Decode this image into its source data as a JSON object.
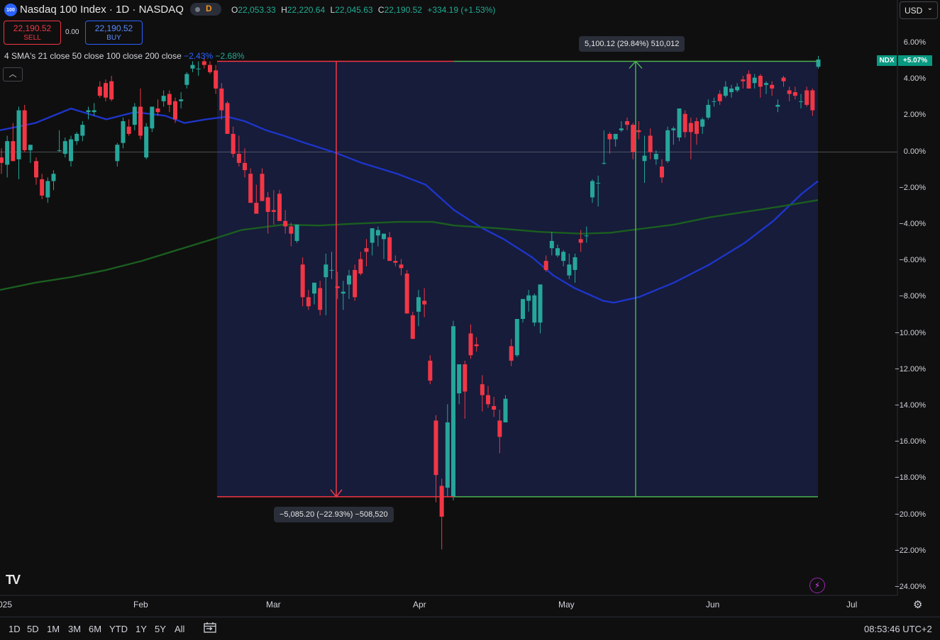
{
  "header": {
    "badge": "100",
    "title": "Nasdaq 100 Index · 1D · NASDAQ",
    "delay_letter": "D",
    "ohlc": [
      {
        "k": "O",
        "v": "22,053.33"
      },
      {
        "k": "H",
        "v": "22,220.64"
      },
      {
        "k": "L",
        "v": "22,045.63"
      },
      {
        "k": "C",
        "v": "22,190.52"
      }
    ],
    "change": "+334.19 (+1.53%)",
    "currency": "USD",
    "currency_chevron": "chevron-down-icon"
  },
  "trade": {
    "sell_price": "22,190.52",
    "sell_label": "SELL",
    "spread": "0.00",
    "buy_price": "22,190.52",
    "buy_label": "BUY"
  },
  "indicator": {
    "label": "4 SMA's 21 close 50 close 100 close 200 close",
    "val1": "−2.43%",
    "val2": "−2.68%",
    "collapse_icon": "chevron-up-icon"
  },
  "price_scale": {
    "labels": [
      "6.00%",
      "4.00%",
      "2.00%",
      "0.00%",
      "−2.00%",
      "−4.00%",
      "−6.00%",
      "−8.00%",
      "−10.00%",
      "−12.00%",
      "−14.00%",
      "−16.00%",
      "−18.00%",
      "−20.00%",
      "−22.00%",
      "−24.00%"
    ],
    "symbol_tag": "NDX",
    "last_pct": "+5.07%"
  },
  "time_scale": {
    "labels": [
      "025",
      "Feb",
      "Mar",
      "Apr",
      "May",
      "Jun",
      "Jul"
    ]
  },
  "measure": {
    "down": "−5,085.20 (−22.93%) −508,520",
    "up": "5,100.12 (29.84%) 510,012"
  },
  "colors": {
    "up": "#26a69a",
    "down": "#f23645",
    "sma_blue": "#1e35c9",
    "sma_green": "#1b5e20",
    "measure_fill": "#161c3a",
    "measure_up": "#4caf50",
    "measure_down": "#f23645"
  },
  "bottom": {
    "timeframes": [
      "1D",
      "5D",
      "1M",
      "3M",
      "6M",
      "YTD",
      "1Y",
      "5Y",
      "All"
    ],
    "clock": "08:53:46 UTC+2",
    "logo": "TV"
  },
  "chart_data": {
    "type": "candlestick",
    "y_unit": "% change",
    "ylim": [
      -24.9,
      6.9
    ],
    "y_ticks": [
      6,
      4,
      2,
      0,
      -2,
      -4,
      -6,
      -8,
      -10,
      -12,
      -14,
      -16,
      -18,
      -20,
      -22,
      -24
    ],
    "x_ticks": [
      "025",
      "Feb",
      "Mar",
      "Apr",
      "May",
      "Jun",
      "Jul"
    ],
    "grid": false,
    "candles": [
      [
        -0.3,
        0.2,
        -1.2,
        -0.6
      ],
      [
        -0.7,
        0.9,
        -1.4,
        0.6
      ],
      [
        0.6,
        1.6,
        -0.5,
        -0.5
      ],
      [
        -0.4,
        2.5,
        -1.5,
        2.3
      ],
      [
        2.3,
        2.6,
        0.0,
        0.1
      ],
      [
        0.1,
        0.3,
        -0.6,
        0.4
      ],
      [
        -0.5,
        -0.3,
        -1.8,
        -1.4
      ],
      [
        -1.5,
        -1.2,
        -2.6,
        -2.4
      ],
      [
        -2.5,
        -1.4,
        -2.8,
        -1.6
      ],
      [
        -1.6,
        -1.0,
        -2.1,
        -1.2
      ],
      [
        0.1,
        1.2,
        0.0,
        0.1
      ],
      [
        -0.1,
        0.8,
        -0.3,
        0.6
      ],
      [
        -0.5,
        0.9,
        -0.8,
        0.7
      ],
      [
        0.6,
        1.1,
        0.4,
        1.0
      ],
      [
        0.9,
        1.7,
        0.6,
        1.5
      ],
      [
        2.2,
        2.5,
        1.8,
        2.3
      ],
      [
        2.2,
        2.7,
        2.0,
        2.3
      ],
      [
        3.6,
        3.9,
        3.0,
        3.1
      ],
      [
        3.8,
        4.0,
        2.8,
        3.0
      ],
      [
        3.9,
        4.2,
        2.8,
        2.9
      ],
      [
        -0.5,
        0.5,
        -0.8,
        0.4
      ],
      [
        0.5,
        1.9,
        0.2,
        1.7
      ],
      [
        1.4,
        1.8,
        0.9,
        1.0
      ],
      [
        1.5,
        2.7,
        1.2,
        2.5
      ],
      [
        2.5,
        3.5,
        0.7,
        0.9
      ],
      [
        -0.3,
        1.6,
        -0.4,
        1.4
      ],
      [
        1.3,
        2.5,
        1.1,
        2.5
      ],
      [
        2.4,
        2.9,
        2.0,
        2.2
      ],
      [
        2.8,
        3.4,
        2.5,
        3.1
      ],
      [
        3.2,
        3.4,
        2.2,
        2.6
      ],
      [
        2.8,
        3.0,
        1.6,
        1.8
      ],
      [
        2.8,
        3.3,
        2.4,
        2.9
      ],
      [
        3.7,
        4.4,
        3.5,
        4.3
      ],
      [
        4.6,
        5.0,
        4.4,
        4.8
      ],
      [
        4.6,
        5.0,
        4.2,
        4.6
      ],
      [
        5.0,
        5.2,
        4.6,
        4.8
      ],
      [
        4.8,
        5.0,
        4.3,
        4.4
      ],
      [
        4.5,
        4.8,
        3.2,
        3.5
      ],
      [
        3.5,
        3.8,
        1.8,
        2.3
      ],
      [
        2.7,
        2.8,
        1.2,
        1.0
      ],
      [
        1.0,
        1.4,
        -0.3,
        -0.1
      ],
      [
        -0.1,
        0.9,
        -0.8,
        -0.6
      ],
      [
        -0.6,
        0.2,
        -1.4,
        -1.0
      ],
      [
        -1.2,
        -0.9,
        -2.8,
        -2.8
      ],
      [
        -2.8,
        -1.8,
        -3.4,
        -3.4
      ],
      [
        -1.2,
        -0.9,
        -2.7,
        -2.7
      ],
      [
        -2.5,
        -2.2,
        -4.5,
        -3.3
      ],
      [
        -3.2,
        -2.1,
        -4.0,
        -3.3
      ],
      [
        -2.3,
        -2.1,
        -3.8,
        -3.8
      ],
      [
        -3.8,
        -3.2,
        -4.5,
        -4.1
      ],
      [
        -4.1,
        -3.9,
        -5.2,
        -4.5
      ],
      [
        -4.9,
        -4.0,
        -5.0,
        -4.0
      ],
      [
        -6.2,
        -5.8,
        -8.5,
        -8.0
      ],
      [
        -8.0,
        -7.6,
        -8.7,
        -8.5
      ],
      [
        -7.8,
        -7.4,
        -8.4,
        -7.2
      ],
      [
        -7.5,
        -7.1,
        -9.0,
        -8.7
      ],
      [
        -6.9,
        -5.6,
        -9.0,
        -6.2
      ],
      [
        -6.5,
        -5.5,
        -7.0,
        -6.5
      ],
      [
        -7.4,
        -6.6,
        -8.1,
        -7.5
      ],
      [
        -7.8,
        -7.1,
        -8.7,
        -7.7
      ],
      [
        -7.3,
        -6.5,
        -8.1,
        -6.8
      ],
      [
        -6.5,
        -6.2,
        -8.2,
        -8.0
      ],
      [
        -5.9,
        -5.5,
        -6.8,
        -6.7
      ],
      [
        -5.3,
        -4.8,
        -6.3,
        -5.5
      ],
      [
        -5.0,
        -4.5,
        -5.7,
        -4.2
      ],
      [
        -4.6,
        -4.1,
        -5.2,
        -4.3
      ],
      [
        -4.8,
        -4.5,
        -5.9,
        -4.5
      ],
      [
        -4.7,
        -4.4,
        -6.0,
        -6.0
      ],
      [
        -6.0,
        -5.7,
        -6.3,
        -6.1
      ],
      [
        -6.2,
        -5.9,
        -6.8,
        -6.4
      ],
      [
        -6.7,
        -6.5,
        -8.9,
        -8.9
      ],
      [
        -9.0,
        -8.8,
        -10.3,
        -10.3
      ],
      [
        -8.8,
        -7.6,
        -9.6,
        -8.0
      ],
      [
        -8.2,
        -7.5,
        -9.1,
        -8.4
      ],
      [
        -11.5,
        -11.2,
        -12.8,
        -12.6
      ],
      [
        -14.8,
        -14.5,
        -19.3,
        -17.8
      ],
      [
        -18.4,
        -18.0,
        -21.9,
        -20.1
      ],
      [
        -18.5,
        -13.9,
        -19.0,
        -14.9
      ],
      [
        -19.0,
        -9.3,
        -19.2,
        -9.6
      ],
      [
        -13.3,
        -12.0,
        -13.9,
        -11.7
      ],
      [
        -11.7,
        -11.5,
        -14.7,
        -13.2
      ],
      [
        -10.0,
        -9.5,
        -11.4,
        -11.2
      ],
      [
        -10.6,
        -10.2,
        -11.0,
        -10.7
      ],
      [
        -12.8,
        -12.3,
        -14.3,
        -13.4
      ],
      [
        -13.4,
        -12.9,
        -14.1,
        -13.9
      ],
      [
        -14.0,
        -13.5,
        -14.6,
        -14.2
      ],
      [
        -14.8,
        -14.2,
        -16.6,
        -15.7
      ],
      [
        -14.9,
        -13.4,
        -14.9,
        -13.6
      ],
      [
        -10.7,
        -10.3,
        -11.8,
        -11.5
      ],
      [
        -11.2,
        -9.2,
        -11.3,
        -9.2
      ],
      [
        -9.2,
        -8.1,
        -9.4,
        -8.1
      ],
      [
        -8.2,
        -7.6,
        -8.8,
        -7.9
      ],
      [
        -9.4,
        -7.8,
        -9.6,
        -7.9
      ],
      [
        -9.4,
        -7.3,
        -10.0,
        -7.3
      ],
      [
        -6.0,
        -5.7,
        -6.6,
        -6.5
      ],
      [
        -5.3,
        -4.4,
        -5.7,
        -4.9
      ],
      [
        -5.7,
        -5.1,
        -5.8,
        -5.3
      ],
      [
        -6.0,
        -5.4,
        -6.3,
        -5.5
      ],
      [
        -6.8,
        -5.6,
        -7.0,
        -6.2
      ],
      [
        -6.5,
        -5.6,
        -7.2,
        -5.8
      ],
      [
        -4.8,
        -4.3,
        -5.5,
        -5.0
      ],
      [
        -4.6,
        -4.1,
        -5.0,
        -4.6
      ],
      [
        -2.5,
        -1.5,
        -2.8,
        -1.6
      ],
      [
        -1.7,
        -1.3,
        -3.0,
        -1.7
      ],
      [
        -0.6,
        1.2,
        -0.7,
        -0.6
      ],
      [
        1.0,
        1.1,
        -0.1,
        0.7
      ],
      [
        0.7,
        1.0,
        0.3,
        1.0
      ],
      [
        1.2,
        1.7,
        1.1,
        1.3
      ],
      [
        1.7,
        1.9,
        1.2,
        1.5
      ],
      [
        1.5,
        1.6,
        -0.4,
        0.0
      ],
      [
        1.2,
        1.7,
        0.7,
        1.1
      ],
      [
        -0.5,
        0.9,
        -1.7,
        -0.2
      ],
      [
        0.9,
        1.3,
        -0.4,
        0.0
      ],
      [
        -0.4,
        0.1,
        -0.7,
        -0.1
      ],
      [
        -0.8,
        -0.4,
        -1.7,
        -1.4
      ],
      [
        -0.5,
        1.4,
        -0.6,
        1.2
      ],
      [
        1.2,
        1.4,
        0.4,
        1.3
      ],
      [
        0.8,
        2.4,
        0.6,
        2.4
      ],
      [
        2.1,
        2.3,
        0.8,
        1.1
      ],
      [
        1.6,
        1.9,
        -0.4,
        1.1
      ],
      [
        1.7,
        1.9,
        0.4,
        1.0
      ],
      [
        1.4,
        1.9,
        1.0,
        1.8
      ],
      [
        1.9,
        2.9,
        1.8,
        2.6
      ],
      [
        2.8,
        3.0,
        2.5,
        2.8
      ],
      [
        3.2,
        3.4,
        2.6,
        2.8
      ],
      [
        3.1,
        3.9,
        3.0,
        3.6
      ],
      [
        3.3,
        3.7,
        3.0,
        3.5
      ],
      [
        3.4,
        3.8,
        3.3,
        3.6
      ],
      [
        4.0,
        4.2,
        3.5,
        3.9
      ],
      [
        4.3,
        4.5,
        3.6,
        3.5
      ],
      [
        3.8,
        4.3,
        3.5,
        4.1
      ],
      [
        4.2,
        4.3,
        3.0,
        3.6
      ],
      [
        3.7,
        3.9,
        3.2,
        3.8
      ],
      [
        3.7,
        3.9,
        3.1,
        3.5
      ],
      [
        2.5,
        2.9,
        2.2,
        2.6
      ],
      [
        4.1,
        4.2,
        3.6,
        3.9
      ],
      [
        3.4,
        3.6,
        2.8,
        3.2
      ],
      [
        3.3,
        3.6,
        2.9,
        3.1
      ],
      [
        2.8,
        3.2,
        2.4,
        2.8
      ],
      [
        3.4,
        3.6,
        2.5,
        2.6
      ],
      [
        3.4,
        3.5,
        2.0,
        2.3
      ],
      [
        4.7,
        5.3,
        4.6,
        5.1
      ]
    ],
    "series": [
      {
        "name": "SMA 50",
        "values": [
          [
            0,
            1.2
          ],
          [
            50,
            1.6
          ],
          [
            100,
            2.4
          ],
          [
            150,
            1.8
          ],
          [
            190,
            2.2
          ],
          [
            233,
            2.0
          ],
          [
            260,
            1.6
          ],
          [
            290,
            1.8
          ],
          [
            320,
            1.95
          ],
          [
            345,
            1.7
          ],
          [
            375,
            1.2
          ],
          [
            400,
            0.9
          ],
          [
            430,
            0.5
          ],
          [
            470,
            0.0
          ],
          [
            510,
            -0.6
          ],
          [
            560,
            -1.2
          ],
          [
            600,
            -1.8
          ],
          [
            640,
            -3.2
          ],
          [
            680,
            -4.2
          ],
          [
            710,
            -4.8
          ],
          [
            750,
            -5.8
          ],
          [
            780,
            -6.8
          ],
          [
            810,
            -7.5
          ],
          [
            850,
            -8.2
          ],
          [
            865,
            -8.3
          ],
          [
            900,
            -8.0
          ],
          [
            950,
            -7.2
          ],
          [
            1000,
            -6.2
          ],
          [
            1050,
            -5.0
          ],
          [
            1090,
            -3.8
          ],
          [
            1130,
            -2.3
          ],
          [
            1153,
            -1.6
          ]
        ]
      },
      {
        "name": "SMA 200",
        "values": [
          [
            0,
            -7.6
          ],
          [
            50,
            -7.2
          ],
          [
            100,
            -6.9
          ],
          [
            150,
            -6.5
          ],
          [
            200,
            -6.0
          ],
          [
            250,
            -5.4
          ],
          [
            300,
            -4.8
          ],
          [
            340,
            -4.3
          ],
          [
            400,
            -4.0
          ],
          [
            450,
            -4.05
          ],
          [
            500,
            -3.95
          ],
          [
            560,
            -3.85
          ],
          [
            610,
            -3.85
          ],
          [
            640,
            -4.05
          ],
          [
            700,
            -4.2
          ],
          [
            760,
            -4.4
          ],
          [
            820,
            -4.5
          ],
          [
            860,
            -4.45
          ],
          [
            900,
            -4.25
          ],
          [
            950,
            -4.0
          ],
          [
            1000,
            -3.6
          ],
          [
            1050,
            -3.3
          ],
          [
            1100,
            -3.0
          ],
          [
            1153,
            -2.65
          ]
        ]
      }
    ],
    "measure_down": {
      "x": [
        306,
        640
      ],
      "y": [
        5.0,
        -19.0
      ]
    },
    "measure_up": {
      "x": [
        640,
        1153
      ],
      "y": [
        -19.0,
        5.0
      ]
    }
  }
}
